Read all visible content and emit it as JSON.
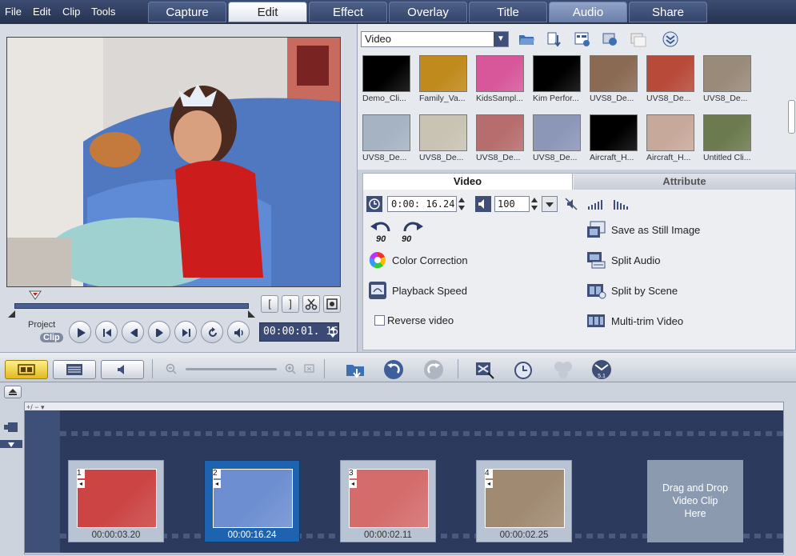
{
  "menu": [
    "File",
    "Edit",
    "Clip",
    "Tools"
  ],
  "steps": [
    {
      "label": "Capture",
      "active": false
    },
    {
      "label": "Edit",
      "active": true
    },
    {
      "label": "Effect",
      "active": false
    },
    {
      "label": "Overlay",
      "active": false
    },
    {
      "label": "Title",
      "active": false
    },
    {
      "label": "Audio",
      "active": false
    },
    {
      "label": "Share",
      "active": false
    }
  ],
  "preview": {
    "project_label": "Project",
    "clip_label": "Clip",
    "timecode": "00:00:01. 16",
    "trim_in": "[",
    "trim_out": "]"
  },
  "library": {
    "category": "Video",
    "thumbnails": [
      {
        "caption": "Demo_Cli...",
        "color": "#000000"
      },
      {
        "caption": "Family_Va...",
        "color": "#c08a1c"
      },
      {
        "caption": "KidsSampl...",
        "color": "#d7579a"
      },
      {
        "caption": "Kim Perfor...",
        "color": "#000000"
      },
      {
        "caption": "UVS8_De...",
        "color": "#8a6a52"
      },
      {
        "caption": "UVS8_De...",
        "color": "#b84a3a"
      },
      {
        "caption": "UVS8_De...",
        "color": "#9a8a7a"
      },
      {
        "caption": "UVS8_De...",
        "color": "#a6b3c3"
      },
      {
        "caption": "UVS8_De...",
        "color": "#c9c3b3"
      },
      {
        "caption": "UVS8_De...",
        "color": "#b76d6d"
      },
      {
        "caption": "UVS8_De...",
        "color": "#8c97b8"
      },
      {
        "caption": "Aircraft_H...",
        "color": "#000000"
      },
      {
        "caption": "Aircraft_H...",
        "color": "#c7a99b"
      },
      {
        "caption": "Untitled Cli...",
        "color": "#6c7b4f"
      }
    ]
  },
  "options": {
    "tab_video": "Video",
    "tab_attribute": "Attribute",
    "duration": "0:00: 16.24",
    "volume": "100",
    "save_still": "Save as Still Image",
    "color_correction": "Color Correction",
    "split_audio": "Split Audio",
    "playback_speed": "Playback Speed",
    "split_scene": "Split by Scene",
    "reverse_video": "Reverse video",
    "multi_trim": "Multi-trim Video",
    "rotate_left": "90",
    "rotate_right": "90"
  },
  "storyboard": {
    "add_remove_label": "+/ − ▾",
    "clips": [
      {
        "number": "1",
        "duration": "00:00:03.20",
        "selected": false,
        "color": "#c44"
      },
      {
        "number": "2",
        "duration": "00:00:16.24",
        "selected": true,
        "color": "#6d8fd1"
      },
      {
        "number": "3",
        "duration": "00:00:02.11",
        "selected": false,
        "color": "#d46c6c"
      },
      {
        "number": "4",
        "duration": "00:00:02.25",
        "selected": false,
        "color": "#a08a72"
      }
    ],
    "drop_text_1": "Drag and Drop",
    "drop_text_2": "Video Clip",
    "drop_text_3": "Here"
  }
}
